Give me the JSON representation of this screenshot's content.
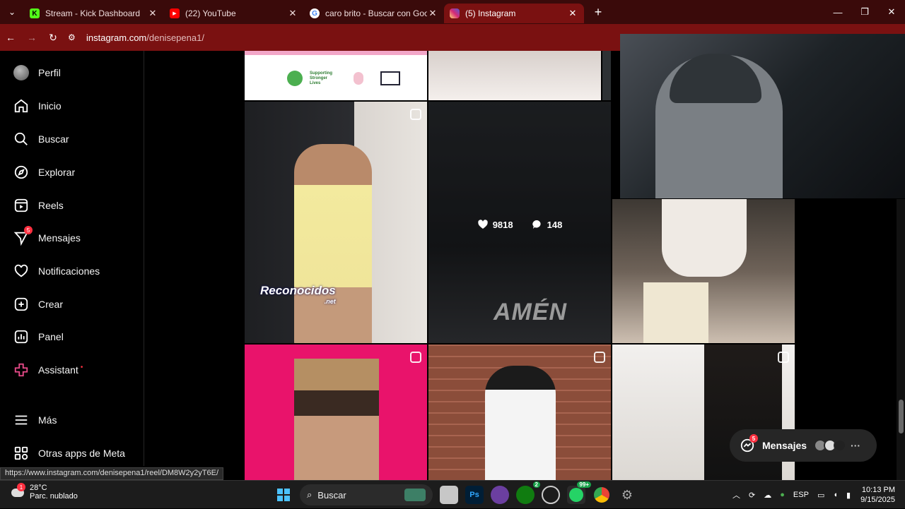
{
  "browser": {
    "tabs": [
      {
        "title": "Stream - Kick Dashboard",
        "favicon": "kick-icon",
        "color": "#53fc18",
        "active": false
      },
      {
        "title": "(22) YouTube",
        "favicon": "youtube-icon",
        "color": "#ff0000",
        "active": false
      },
      {
        "title": "caro brito - Buscar con Google",
        "favicon": "google-icon",
        "color": "#4285f4",
        "active": false
      },
      {
        "title": "(5) Instagram",
        "favicon": "instagram-icon",
        "color": "#e1306c",
        "active": true
      }
    ],
    "url_host": "instagram.com",
    "url_path": "/denisepena1/",
    "status_url": "https://www.instagram.com/denisepena1/reel/DM8W2y2yT6E/"
  },
  "sidebar": {
    "items": [
      {
        "label": "Perfil",
        "icon": "profile-avatar-icon"
      },
      {
        "label": "Inicio",
        "icon": "home-icon"
      },
      {
        "label": "Buscar",
        "icon": "search-icon"
      },
      {
        "label": "Explorar",
        "icon": "compass-icon"
      },
      {
        "label": "Reels",
        "icon": "reels-icon"
      },
      {
        "label": "Mensajes",
        "icon": "messenger-icon",
        "badge": "5"
      },
      {
        "label": "Notificaciones",
        "icon": "heart-icon"
      },
      {
        "label": "Crear",
        "icon": "plus-square-icon"
      },
      {
        "label": "Panel",
        "icon": "chart-icon"
      },
      {
        "label": "Assistant",
        "icon": "assistant-icon"
      },
      {
        "label": "Más",
        "icon": "hamburger-icon"
      },
      {
        "label": "Otras apps de Meta",
        "icon": "apps-icon"
      }
    ]
  },
  "grid": {
    "hover_likes": "9818",
    "hover_comments": "148",
    "watermark": "Reconocidos",
    "watermark_sub": ".net",
    "overlay_text": "AMÉN",
    "banner_line1": "Supporting",
    "banner_line2": "Stronger",
    "banner_line3": "Lives"
  },
  "messages_pill": {
    "label": "Mensajes",
    "badge": "5"
  },
  "taskbar": {
    "weather_temp": "28°C",
    "weather_desc": "Parc. nublado",
    "weather_badge": "1",
    "search_label": "Buscar",
    "xbox_badge": "2",
    "whatsapp_badge": "99+",
    "lang": "ESP",
    "time": "10:13 PM",
    "date": "9/15/2025"
  },
  "colors": {
    "accent": "#7a1111",
    "tabstrip": "#3a0a0a",
    "badge": "#ff3040"
  }
}
